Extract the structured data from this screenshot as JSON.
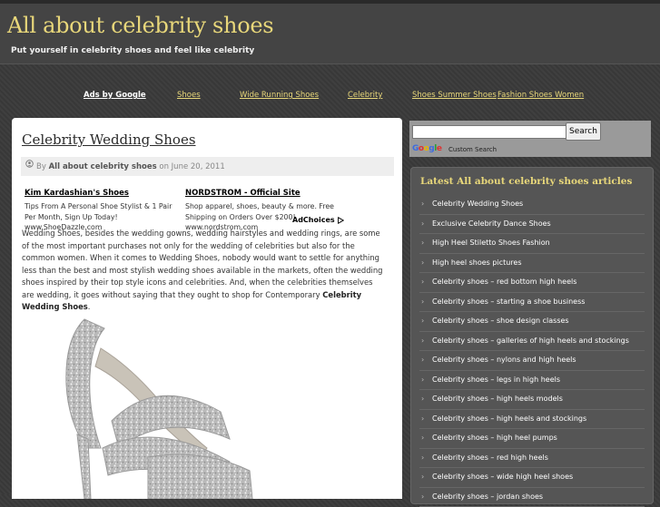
{
  "site": {
    "title": "All about celebrity shoes",
    "tagline": "Put yourself in celebrity shoes and feel like celebrity"
  },
  "nav": {
    "ads_label": "Ads by Google",
    "links": [
      "Shoes",
      "Wide Running Shoes",
      "Celebrity",
      "Shoes Summer Shoes",
      "Fashion Shoes Women"
    ]
  },
  "post": {
    "title": "Celebrity Wedding Shoes",
    "meta_by": "By",
    "author": "All about celebrity shoes",
    "meta_on": "on June 20, 2011",
    "body": "Wedding Shoes, besides the wedding gowns, wedding hairstyles and wedding rings, are some of the most important purchases not only for the wedding of celebrities but also for the common women. When it comes to Wedding Shoes, nobody would want to settle for anything less than the best and most stylish wedding shoes available in the markets, often the wedding shoes inspired by their top style icons and celebrities. And, when the celebrities themselves are wedding, it goes without saying that they ought to shop for Contemporary",
    "body_bold": "Celebrity Wedding Shoes",
    "body_end": "."
  },
  "ads": [
    {
      "title": "Kim Kardashian's Shoes",
      "text": "Tips From A Personal Shoe Stylist & 1 Pair Per Month, Sign Up Today!",
      "url": "www.ShoeDazzle.com"
    },
    {
      "title": "NORDSTROM - Official Site",
      "text": "Shop apparel, shoes, beauty & more. Free Shipping on Orders Over $200!",
      "url": "www.nordstrom.com"
    }
  ],
  "adchoices_label": "AdChoices",
  "search": {
    "button_label": "Search",
    "google_g": "G",
    "google_o1": "o",
    "google_o2": "o",
    "google_g2": "g",
    "google_l": "l",
    "google_e": "e",
    "custom_label": "Custom Search"
  },
  "sidebar": {
    "title": "Latest All about celebrity shoes articles",
    "items": [
      "Celebrity Wedding Shoes",
      "Exclusive Celebrity Dance Shoes",
      "High Heel Stiletto Shoes Fashion",
      "High heel shoes pictures",
      "Celebrity shoes – red bottom high heels",
      "Celebrity shoes – starting a shoe business",
      "Celebrity shoes – shoe design classes",
      "Celebrity shoes – galleries of high heels and stockings",
      "Celebrity shoes – nylons and high heels",
      "Celebrity shoes – legs in high heels",
      "Celebrity shoes – high heels models",
      "Celebrity shoes – high heels and stockings",
      "Celebrity shoes – high heel pumps",
      "Celebrity shoes – red high heels",
      "Celebrity shoes – wide high heel shoes",
      "Celebrity shoes – jordan shoes"
    ]
  },
  "colors": {
    "accent": "#e8d77a",
    "background": "#3a3a3a",
    "sidebar": "#555555"
  }
}
